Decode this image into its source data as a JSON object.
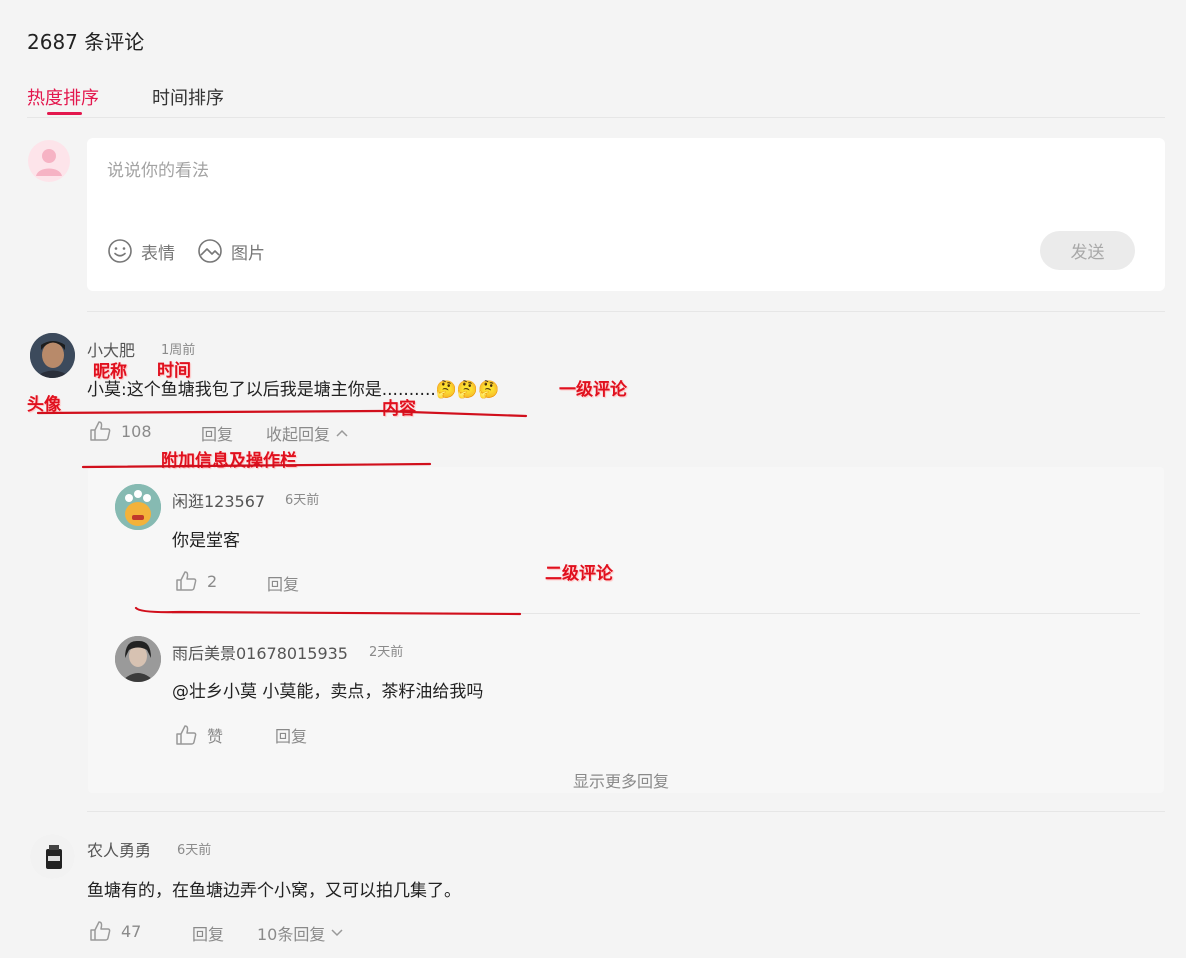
{
  "header": {
    "count": "2687 条评论",
    "tabs": [
      {
        "label": "热度排序",
        "active": true
      },
      {
        "label": "时间排序",
        "active": false
      }
    ]
  },
  "composer": {
    "placeholder": "说说你的看法",
    "emoji_label": "表情",
    "image_label": "图片",
    "send_label": "发送"
  },
  "comments": [
    {
      "nick": "小大肥",
      "time": "1周前",
      "content": "小莫:这个鱼塘我包了以后我是塘主你是..........🤔🤔🤔",
      "likes": "108",
      "reply_label": "回复",
      "toggle_label": "收起回复",
      "replies": [
        {
          "nick": "闲逛123567",
          "time": "6天前",
          "content": "你是堂客",
          "likes": "2",
          "reply_label": "回复"
        },
        {
          "nick": "雨后美景01678015935",
          "time": "2天前",
          "mention": "@壮乡小莫",
          "content": " 小莫能，卖点，茶籽油给我吗",
          "likes": "赞",
          "reply_label": "回复"
        }
      ],
      "more_replies": "显示更多回复"
    },
    {
      "nick": "农人勇勇",
      "time": "6天前",
      "content": "鱼塘有的，在鱼塘边弄个小窝，又可以拍几集了。",
      "likes": "47",
      "reply_label": "回复",
      "toggle_label": "10条回复"
    }
  ],
  "annotations": {
    "avatar": "头像",
    "nickname": "昵称",
    "time": "时间",
    "content": "内容",
    "level1": "一级评论",
    "actions": "附加信息及操作栏",
    "level2": "二级评论"
  },
  "colors": {
    "accent": "#e3174d",
    "annotation": "#e0101e",
    "background": "#f4f4f4"
  }
}
